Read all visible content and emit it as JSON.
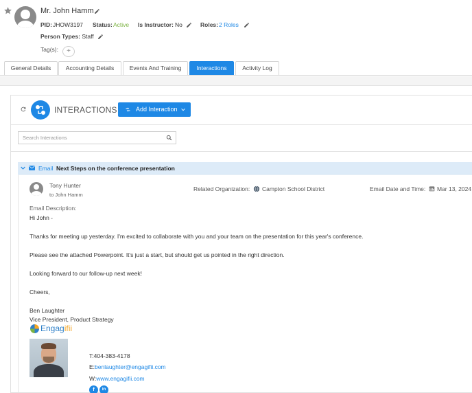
{
  "person": {
    "name": "Mr. John Hamm",
    "pid_label": "PID:",
    "pid_value": "JHOW3197",
    "status_label": "Status:",
    "status_value": "Active",
    "instructor_label": "Is Instructor:",
    "instructor_value": "No",
    "roles_label": "Roles:",
    "roles_value": "2 Roles",
    "person_types_label": "Person Types:",
    "person_types_value": "Staff",
    "tags_label": "Tag(s):",
    "tag_add": "+"
  },
  "tabs": [
    {
      "label": "General Details",
      "active": false
    },
    {
      "label": "Accounting Details",
      "active": false
    },
    {
      "label": "Events And Training",
      "active": false
    },
    {
      "label": "Interactions",
      "active": true
    },
    {
      "label": "Activity Log",
      "active": false
    }
  ],
  "interactions": {
    "title": "INTERACTIONS",
    "add_button": "Add Interaction",
    "search_placeholder": "Search Interactions"
  },
  "email": {
    "type": "Email",
    "subject": "Next Steps on the conference presentation",
    "sender": "Tony Hunter",
    "recipient": "to John Hamm",
    "related_org_label": "Related Organization:",
    "related_org_value": "Campton School District",
    "date_label": "Email Date and Time:",
    "date_value": "Mar 13, 2024",
    "description_label": "Email Description:",
    "body_lines": [
      "Hi John -",
      "Thanks for meeting up yesterday. I'm excited to collaborate with you and your team on the presentation for this year's conference.",
      "Please see the attached Powerpoint. It's just a start, but should get us pointed in the right direction.",
      "Looking forward to our follow-up next week!",
      "Cheers,",
      "Ben Laughter",
      "Vice President, Product Strategy"
    ],
    "signature": {
      "logo_text_a": "Engag",
      "logo_text_b": "ifii",
      "phone": "T:404-383-4178",
      "email_prefix": "E:",
      "email": "benlaughter@engagifii.com",
      "web_prefix": "W:",
      "web": "www.engagifii.com",
      "social_facebook": "f",
      "social_linkedin": "in"
    }
  },
  "colors": {
    "accent": "#1e88e5",
    "status_active": "#7cb342",
    "email_bar": "#ddebf8"
  }
}
